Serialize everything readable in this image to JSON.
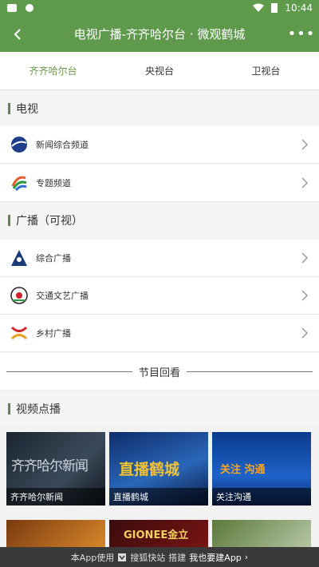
{
  "status_bar": {
    "time": "10:44"
  },
  "app_bar": {
    "title": "电视广播-齐齐哈尔台 · 微观鹤城",
    "back_icon": "back-icon",
    "more_label": "•••"
  },
  "tabs": [
    {
      "label": "齐齐哈尔台",
      "active": true
    },
    {
      "label": "央视台",
      "active": false
    },
    {
      "label": "卫视台",
      "active": false
    }
  ],
  "sections": {
    "tv": {
      "title": "电视"
    },
    "radio": {
      "title": "广播（可视）"
    },
    "vod": {
      "title": "视频点播"
    }
  },
  "tv_items": [
    {
      "label": "新闻综合频道"
    },
    {
      "label": "专题频道"
    }
  ],
  "radio_items": [
    {
      "label": "综合广播"
    },
    {
      "label": "交通文艺广播"
    },
    {
      "label": "乡村广播"
    }
  ],
  "replay": {
    "title": "节目回看"
  },
  "videos": [
    {
      "caption": "齐齐哈尔新闻",
      "image_text": "齐齐哈尔新闻"
    },
    {
      "caption": "直播鹤城",
      "image_text": "直播鹤城"
    },
    {
      "caption": "关注沟通",
      "image_text": "关注 沟通"
    },
    {
      "caption": "",
      "image_text": ""
    },
    {
      "caption": "",
      "image_text": "GIONEE金立"
    },
    {
      "caption": "",
      "image_text": ""
    }
  ],
  "footer": {
    "text": "本App使用",
    "brand": "搜狐快站",
    "built": "搭建",
    "cta": "我也要建App",
    "arrow": "›"
  },
  "colors": {
    "primary": "#5f9a4c",
    "active_tab": "#6a9a4c"
  }
}
